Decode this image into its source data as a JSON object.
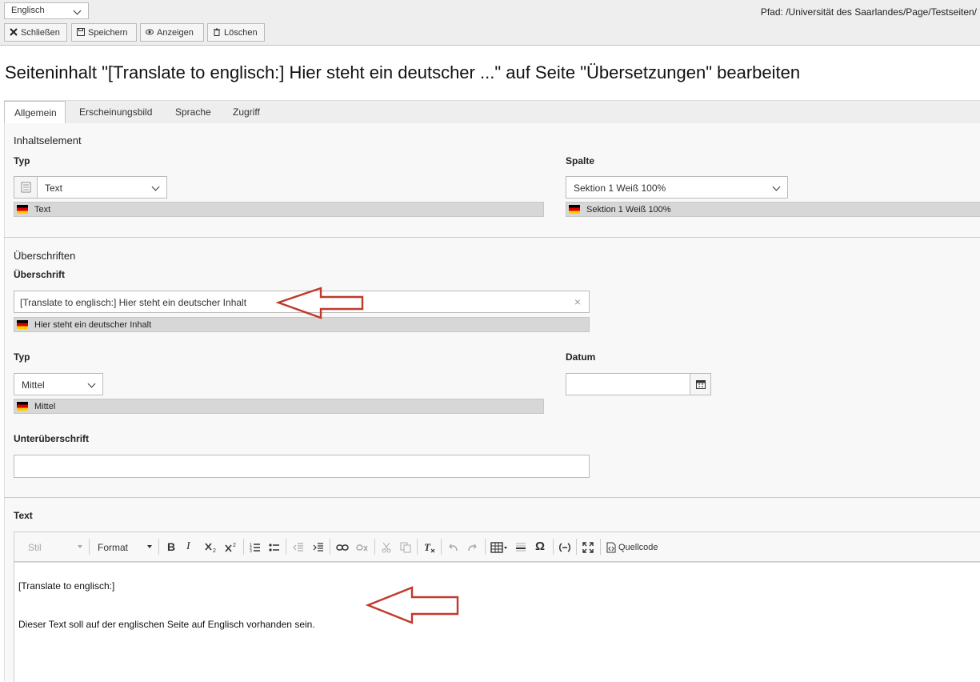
{
  "header": {
    "language_select": "Englisch",
    "path": "Pfad: /Universität des Saarlandes/Page/Testseiten/",
    "buttons": {
      "close": "Schließen",
      "save": "Speichern",
      "view": "Anzeigen",
      "delete": "Löschen"
    }
  },
  "page_title": "Seiteninhalt \"[Translate to englisch:] Hier steht ein deutscher ...\" auf Seite \"Übersetzungen\" bearbeiten",
  "tabs": [
    "Allgemein",
    "Erscheinungsbild",
    "Sprache",
    "Zugriff"
  ],
  "content_element": {
    "section_title": "Inhaltselement",
    "type_label": "Typ",
    "type_value": "Text",
    "type_original": "Text",
    "column_label": "Spalte",
    "column_value": "Sektion 1 Weiß 100%",
    "column_original": "Sektion 1 Weiß 100%"
  },
  "headings": {
    "section_title": "Überschriften",
    "heading_label": "Überschrift",
    "heading_value": "[Translate to englisch:] Hier steht ein deutscher Inhalt",
    "heading_original": "Hier steht ein deutscher Inhalt",
    "clear_symbol": "×",
    "type_label": "Typ",
    "type_value": "Mittel",
    "type_original": "Mittel",
    "date_label": "Datum",
    "date_value": "",
    "subheading_label": "Unterüberschrift",
    "subheading_value": ""
  },
  "text": {
    "label": "Text",
    "toolbar": {
      "style": "Stil",
      "format": "Format",
      "bold": "B",
      "italic": "I",
      "special_char": "Ω",
      "source": "Quellcode"
    },
    "lines": [
      "[Translate to englisch:]",
      "Dieser Text soll auf der englischen Seite auf Englisch vorhanden sein."
    ]
  },
  "colors": {
    "arrow": "#c0392b",
    "flag_black": "#000000",
    "flag_red": "#dd0000",
    "flag_gold": "#ffce00"
  }
}
